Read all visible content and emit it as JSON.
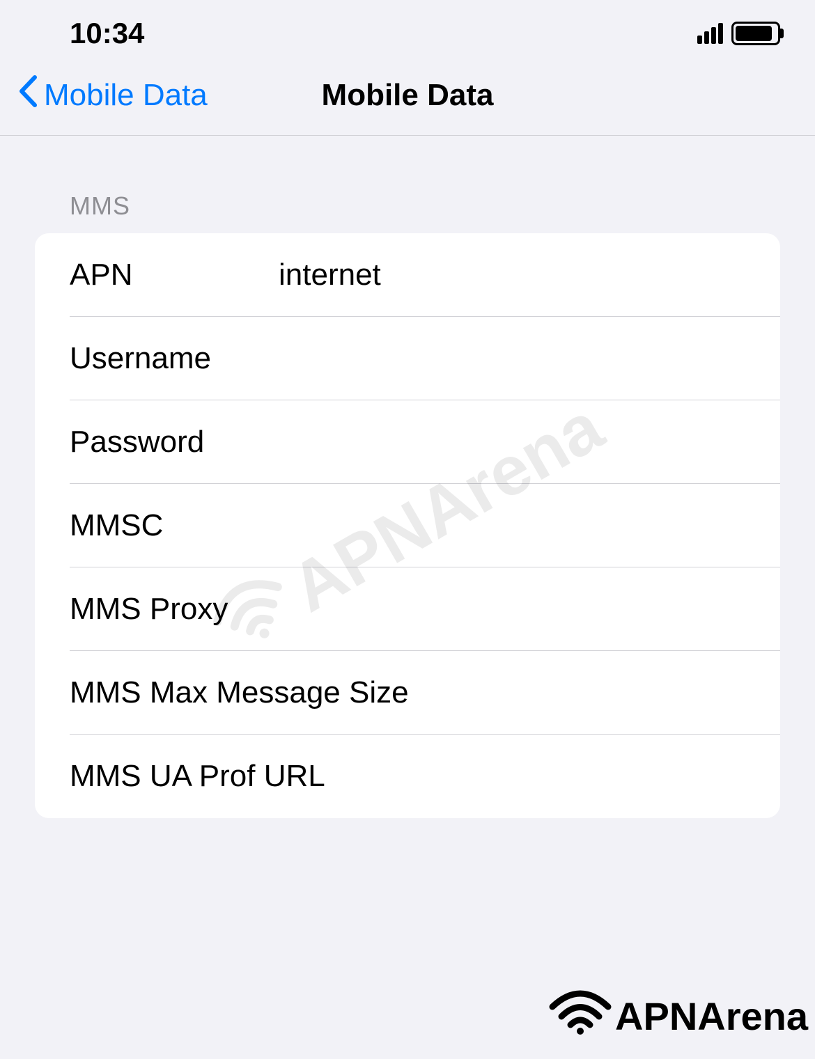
{
  "statusBar": {
    "time": "10:34"
  },
  "navBar": {
    "backLabel": "Mobile Data",
    "title": "Mobile Data"
  },
  "section": {
    "header": "MMS",
    "rows": [
      {
        "label": "APN",
        "value": "internet"
      },
      {
        "label": "Username",
        "value": ""
      },
      {
        "label": "Password",
        "value": ""
      },
      {
        "label": "MMSC",
        "value": ""
      },
      {
        "label": "MMS Proxy",
        "value": ""
      },
      {
        "label": "MMS Max Message Size",
        "value": ""
      },
      {
        "label": "MMS UA Prof URL",
        "value": ""
      }
    ]
  },
  "watermark": {
    "text": "APNArena"
  },
  "footer": {
    "brand": "APNArena"
  }
}
